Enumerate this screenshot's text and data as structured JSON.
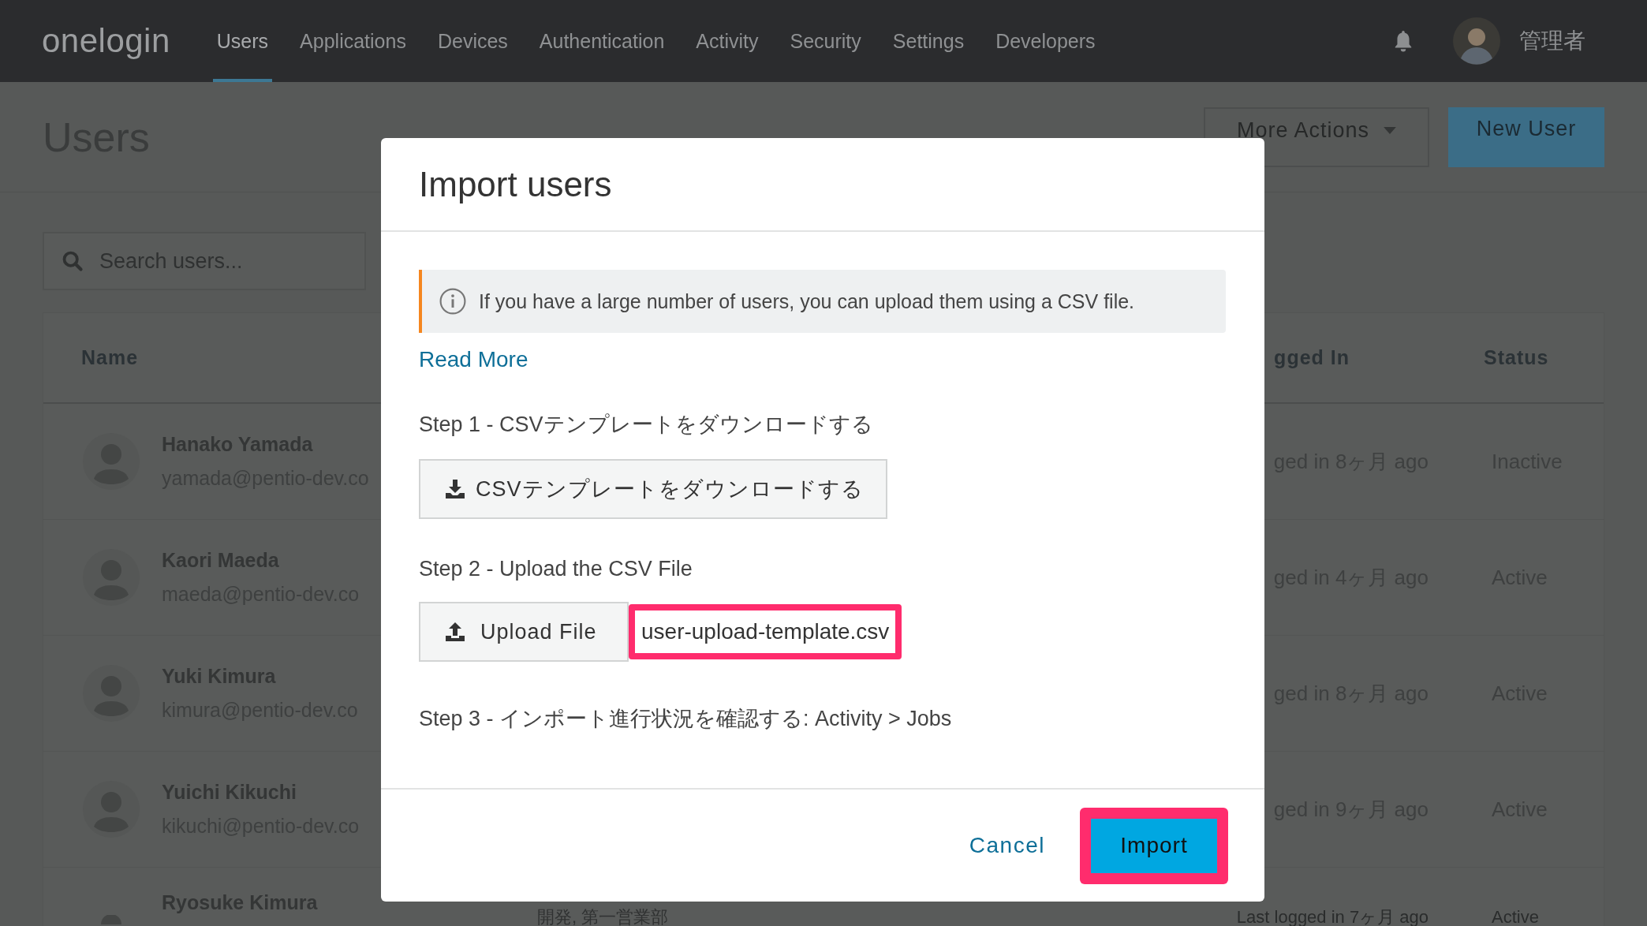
{
  "nav": {
    "logo": "onelogin",
    "items": [
      {
        "label": "Users",
        "selected": true
      },
      {
        "label": "Applications",
        "selected": false
      },
      {
        "label": "Devices",
        "selected": false
      },
      {
        "label": "Authentication",
        "selected": false
      },
      {
        "label": "Activity",
        "selected": false
      },
      {
        "label": "Security",
        "selected": false
      },
      {
        "label": "Settings",
        "selected": false
      },
      {
        "label": "Developers",
        "selected": false
      }
    ],
    "user": "管理者"
  },
  "page": {
    "title": "Users",
    "buttons": [
      {
        "label": "More Actions",
        "kind": "dropdown"
      },
      {
        "label": "New User",
        "kind": "primary"
      }
    ],
    "search": {
      "placeholder": "Search users..."
    }
  },
  "table": {
    "header": {
      "name": "Name",
      "last_login": "gged In",
      "status": "Status"
    },
    "rows": [
      {
        "name": "Hanako Yamada",
        "email": "yamada@pentio-dev.co",
        "last_login": "ged in 8ヶ月 ago",
        "status": "Inactive"
      },
      {
        "name": "Kaori Maeda",
        "email": "maeda@pentio-dev.co",
        "last_login": "ged in 4ヶ月 ago",
        "status": "Active"
      },
      {
        "name": "Yuki Kimura",
        "email": "kimura@pentio-dev.co",
        "last_login": "ged in 8ヶ月 ago",
        "status": "Active"
      },
      {
        "name": "Yuichi Kikuchi",
        "email": "kikuchi@pentio-dev.co",
        "last_login": "ged in 9ヶ月 ago",
        "status": "Active"
      },
      {
        "name": "Ryosuke Kimura",
        "department": "開発, 第一営業部",
        "last_login": "Last logged in 7ヶ月 ago",
        "status": "Active"
      }
    ]
  },
  "dialog": {
    "title": "Import users",
    "notice": "If you have a large number of users, you can upload them using a CSV file.",
    "read_more": "Read More",
    "steps": [
      {
        "label": "Step 1 - CSVテンプレートをダウンロードする",
        "action": {
          "kind": "download",
          "label": "CSVテンプレートをダウンロードする"
        }
      },
      {
        "label": "Step 2 - Upload the CSV File",
        "action": {
          "kind": "upload",
          "label": "Upload File",
          "file": "user-upload-template.csv",
          "highlighted": true
        }
      },
      {
        "label": "Step 3 - インポート進行状況を確認する: Activity > Jobs"
      }
    ],
    "buttons": [
      {
        "label": "Cancel",
        "kind": "link",
        "highlighted": false
      },
      {
        "label": "Import",
        "kind": "primary",
        "highlighted": true
      }
    ]
  }
}
